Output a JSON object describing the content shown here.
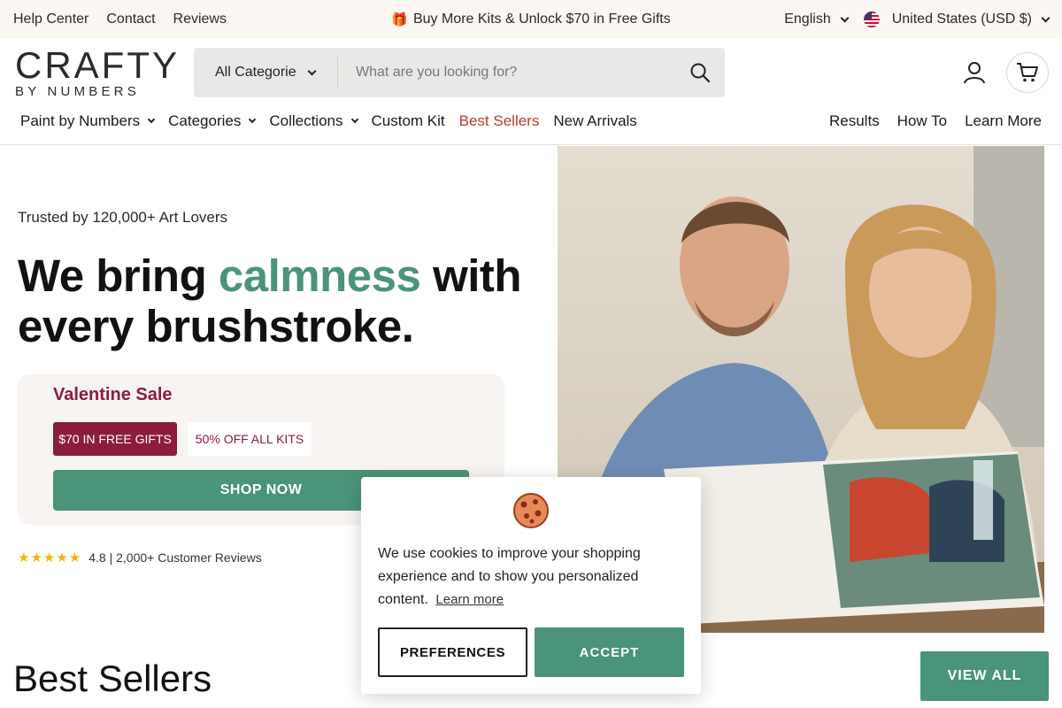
{
  "topbar": {
    "links": [
      "Help Center",
      "Contact",
      "Reviews"
    ],
    "promo_icon": "gift-icon",
    "promo_text": "Buy More Kits & Unlock $70 in Free Gifts",
    "language": "English",
    "currency": "United States (USD $)"
  },
  "header": {
    "logo_main": "CRAFTY",
    "logo_sub": "BY NUMBERS",
    "search_category": "All Categorie",
    "search_placeholder": "What are you looking for?"
  },
  "nav": {
    "left": [
      "Paint by Numbers",
      "Categories",
      "Collections",
      "Custom Kit",
      "Best Sellers",
      "New Arrivals"
    ],
    "right": [
      "Results",
      "How To",
      "Learn More"
    ]
  },
  "hero": {
    "trusted": "Trusted by 120,000+ Art Lovers",
    "headline_1": "We bring ",
    "headline_accent": "calmness",
    "headline_2": " with every brushstroke.",
    "sale_title": "Valentine Sale",
    "pill_a": "$70 IN FREE GIFTS",
    "pill_b": "50% OFF ALL KITS",
    "cta": "SHOP NOW",
    "stars": "★★★★★",
    "rating_text": "4.8 | 2,000+ Customer Reviews"
  },
  "best_sellers": {
    "title": "Best Sellers",
    "view_all": "VIEW ALL"
  },
  "cookie": {
    "text": "We use cookies to improve your shopping experience and to show you personalized content.",
    "learn_more": "Learn more",
    "preferences": "PREFERENCES",
    "accept": "ACCEPT"
  },
  "colors": {
    "brand_green": "#4a9479",
    "sale_red": "#8c1c3b",
    "accent_red": "#c0392b",
    "topbar_bg": "#fbf7f2"
  }
}
